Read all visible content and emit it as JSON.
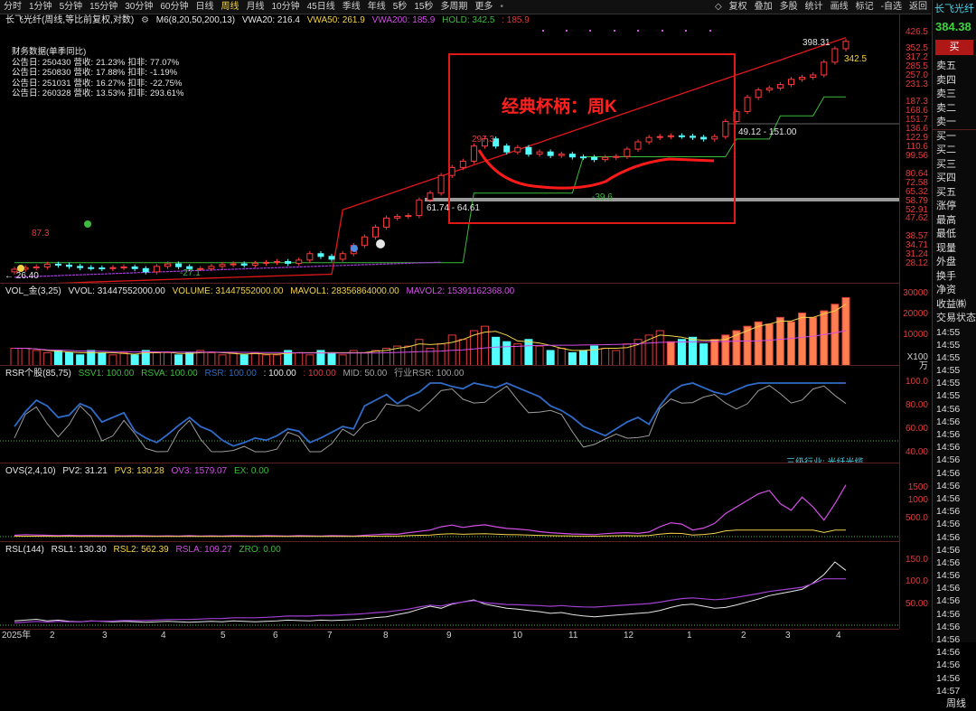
{
  "topbar": {
    "periods": [
      "分时",
      "1分钟",
      "5分钟",
      "15分钟",
      "30分钟",
      "60分钟",
      "日线",
      "周线",
      "月线",
      "10分钟",
      "45日线",
      "季线",
      "年线",
      "5秒",
      "15秒",
      "多周期",
      "更多"
    ],
    "active_period": "周线",
    "menu_dot": "•",
    "right_buttons": [
      "复权",
      "叠加",
      "多股",
      "统计",
      "画线",
      "标记",
      "-自选",
      "返回"
    ],
    "x_symbol": "◇"
  },
  "chart_header": {
    "title": "长飞光纤(周线,等比前复权,对数)",
    "ma_label": "M6(8,20,50,200,13)",
    "vwa20": "VWA20: 216.4",
    "vwa50": "VWA50: 261.9",
    "vwa200": "VWA200: 185.9",
    "hold": "HOLD: 342.5",
    "hold2": ": 185.9"
  },
  "finance": {
    "title": "财务数据(单季同比)",
    "rows": [
      {
        "date": "公告日: 250430",
        "rev_label": "营收:",
        "rev": "21.23%",
        "np_label": "扣非:",
        "np": "77.07%"
      },
      {
        "date": "公告日: 250830",
        "rev_label": "营收:",
        "rev": "17.88%",
        "np_label": "扣非:",
        "np": "-1.19%"
      },
      {
        "date": "公告日: 251031",
        "rev_label": "营收:",
        "rev": "16.27%",
        "np_label": "扣非:",
        "np": "-22.75%"
      },
      {
        "date": "公告日: 260328",
        "rev_label": "营收:",
        "rev": "13.53%",
        "np_label": "扣非:",
        "np": "293.61%"
      }
    ]
  },
  "annotation": {
    "title": "经典杯柄：周K",
    "high1": "297.3",
    "low1": "-39.6",
    "range1": "61.74 - 64.61",
    "range2": "49.12 - 151.00",
    "peak": "398.31",
    "hold_val": "342.5",
    "low_a": "87.3",
    "low_b": "-27.1",
    "start": "← 26.40"
  },
  "price_axis": [
    "426.5",
    "352.5",
    "317.2",
    "285.5",
    "257.0",
    "231.3",
    "187.3",
    "168.6",
    "151.7",
    "136.6",
    "122.9",
    "110.6",
    "99.56",
    "80.64",
    "72.58",
    "65.32",
    "58.79",
    "52.91",
    "47.62",
    "38.57",
    "34.71",
    "31.24",
    "28.12"
  ],
  "vol": {
    "name": "VOL_金(3,25)",
    "vvol": "VVOL: 31447552000.00",
    "volume": "VOLUME: 31447552000.00",
    "mavol1": "MAVOL1: 28356864000.00",
    "mavol2": "MAVOL2: 15391162368.00",
    "axis": [
      "30000",
      "20000",
      "10000"
    ],
    "unit": "X100万"
  },
  "rsr": {
    "name": "RSR个股(85,75)",
    "ssv1": "SSV1: 100.00",
    "rsva": "RSVA: 100.00",
    "rsr": "RSR: 100.00",
    "blank1": ": 100.00",
    "blank2": ": 100.00",
    "mid": "MID: 50.00",
    "ind": "行业RSR: 100.00",
    "axis": [
      "100.0",
      "80.00",
      "60.00",
      "40.00"
    ],
    "industry": "三级行业: 光纤光缆"
  },
  "ovs": {
    "name": "OVS(2,4,10)",
    "pv2": "PV2: 31.21",
    "pv3": "PV3: 130.28",
    "ov3": "OV3: 1579.07",
    "ex": "EX: 0.00",
    "axis": [
      "1500",
      "1000",
      "500.0"
    ]
  },
  "rsl": {
    "name": "RSL(144)",
    "rsl1": "RSL1: 130.30",
    "rsl2": "RSL2: 562.39",
    "rsla": "RSLA: 109.27",
    "zro": "ZRO: 0.00",
    "axis": [
      "150.0",
      "100.0",
      "50.00"
    ]
  },
  "xaxis": [
    "2025年",
    "2",
    "3",
    "4",
    "5",
    "6",
    "7",
    "8",
    "9",
    "10",
    "11",
    "12",
    "1",
    "2",
    "3",
    "4"
  ],
  "side": {
    "name": "长飞光纤",
    "price": "384.38",
    "buy_btn": "买",
    "rows": [
      "卖五",
      "卖四",
      "卖三",
      "卖二",
      "卖一",
      "买一",
      "买二",
      "买三",
      "买四",
      "买五",
      "涨停",
      "最高",
      "最低",
      "现量",
      "外盘",
      "换手",
      "净资",
      "收益㈱",
      "交易状态"
    ],
    "times": [
      "14:55",
      "14:55",
      "14:55",
      "14:55",
      "14:55",
      "14:55",
      "14:56",
      "14:56",
      "14:56",
      "14:56",
      "14:56",
      "14:56",
      "14:56",
      "14:56",
      "14:56",
      "14:56",
      "14:56",
      "14:56",
      "14:56",
      "14:56",
      "14:56",
      "14:56",
      "14:56",
      "14:56",
      "14:56",
      "14:56",
      "14:56",
      "14:56",
      "14:57"
    ],
    "footer": "周线"
  },
  "colors": {
    "up": "#ff3b3b",
    "down": "#54ffff",
    "bg": "#000000",
    "accent": "#f3d34a"
  },
  "chart_data": {
    "type": "candlestick",
    "title": "经典杯柄：周K",
    "ylim": [
      26.4,
      426.5
    ],
    "weekly_close": [
      26.4,
      26.9,
      27.1,
      28.0,
      27.7,
      27.3,
      26.9,
      26.8,
      26.6,
      26.9,
      27.1,
      26.6,
      25.6,
      27.3,
      28.1,
      27.2,
      26.6,
      26.6,
      27.3,
      27.9,
      28.1,
      27.7,
      28.3,
      28.6,
      28.9,
      28.3,
      29.4,
      31.7,
      30.7,
      29.7,
      31.7,
      34.9,
      38.6,
      43.3,
      48.2,
      49.1,
      49.6,
      59.6,
      64.6,
      79.5,
      87.3,
      94.0,
      112.3,
      122.2,
      112.3,
      104.8,
      110.4,
      102.1,
      104.8,
      100.5,
      102.1,
      98.8,
      98.3,
      95.8,
      98.3,
      99.4,
      108.3,
      118.0,
      124.2,
      125.5,
      126.7,
      126.0,
      124.4,
      122.0,
      125.5,
      150.0,
      168.6,
      199.0,
      217.0,
      222.0,
      231.3,
      246.0,
      252.0,
      259.0,
      301.0,
      352.5,
      384.4
    ]
  }
}
